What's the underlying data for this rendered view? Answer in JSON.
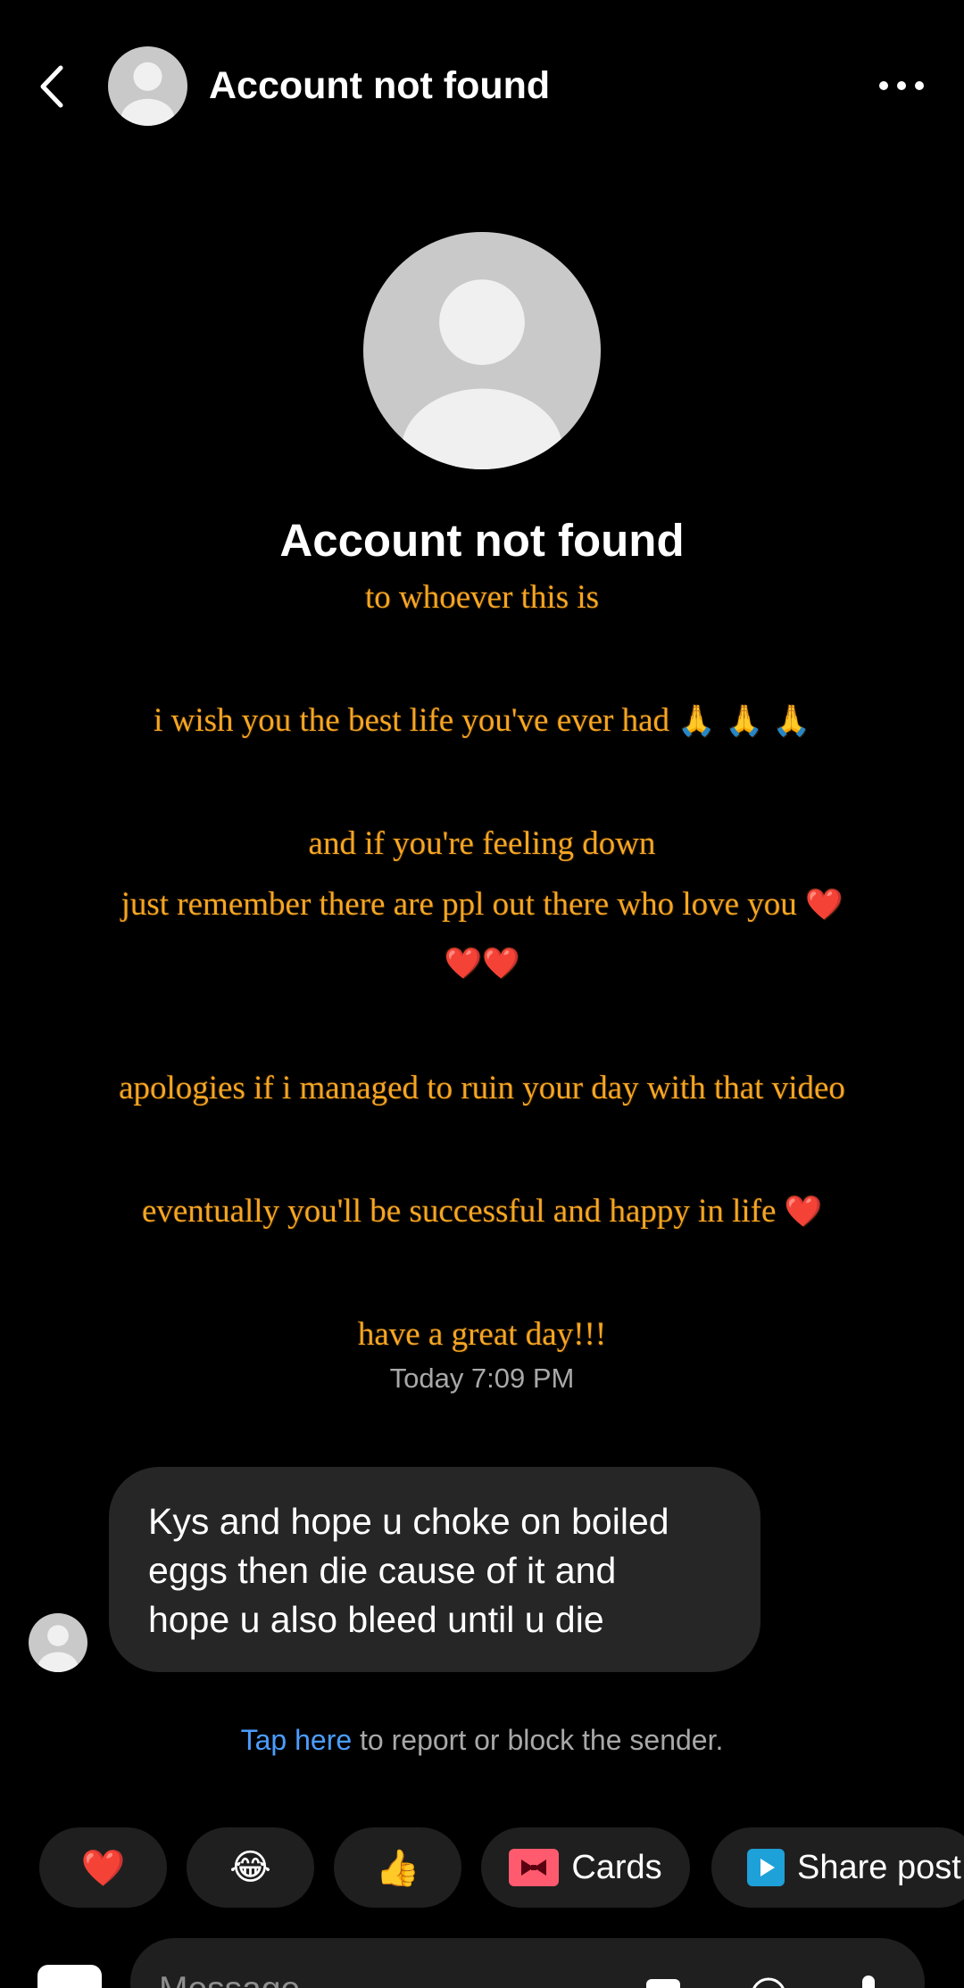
{
  "header": {
    "title": "Account not found"
  },
  "profile": {
    "name": "Account not found"
  },
  "overlay": {
    "line1": "to whoever this is",
    "line2": "i wish you the best life you've ever had",
    "line2_emoji": "🙏 🙏 🙏",
    "line3": "and if you're feeling down",
    "line4": "just remember there are ppl out there who love you",
    "line4_emoji": "❤️",
    "line5_emoji": "❤️❤️",
    "line6": "apologies if i managed to ruin your day with that video",
    "line7": "eventually you'll be successful and happy in life",
    "line7_emoji": "❤️",
    "line8": "have a great day!!!"
  },
  "conversation": {
    "timestamp": "Today 7:09 PM",
    "message_text": "Kys and hope u choke on boiled\neggs then die cause of it and\nhope u also bleed until u die",
    "report_link": "Tap here",
    "report_rest": " to report or block the sender."
  },
  "quick_replies": {
    "heart": "❤️",
    "laugh": "😂",
    "thumbs": "👍",
    "cards_label": "Cards",
    "share_label": "Share post"
  },
  "composer": {
    "placeholder": "Message"
  },
  "colors": {
    "overlay_text": "#f5a623",
    "link": "#4b9dff",
    "bubble": "#262626",
    "chip": "#1f1f1f"
  }
}
